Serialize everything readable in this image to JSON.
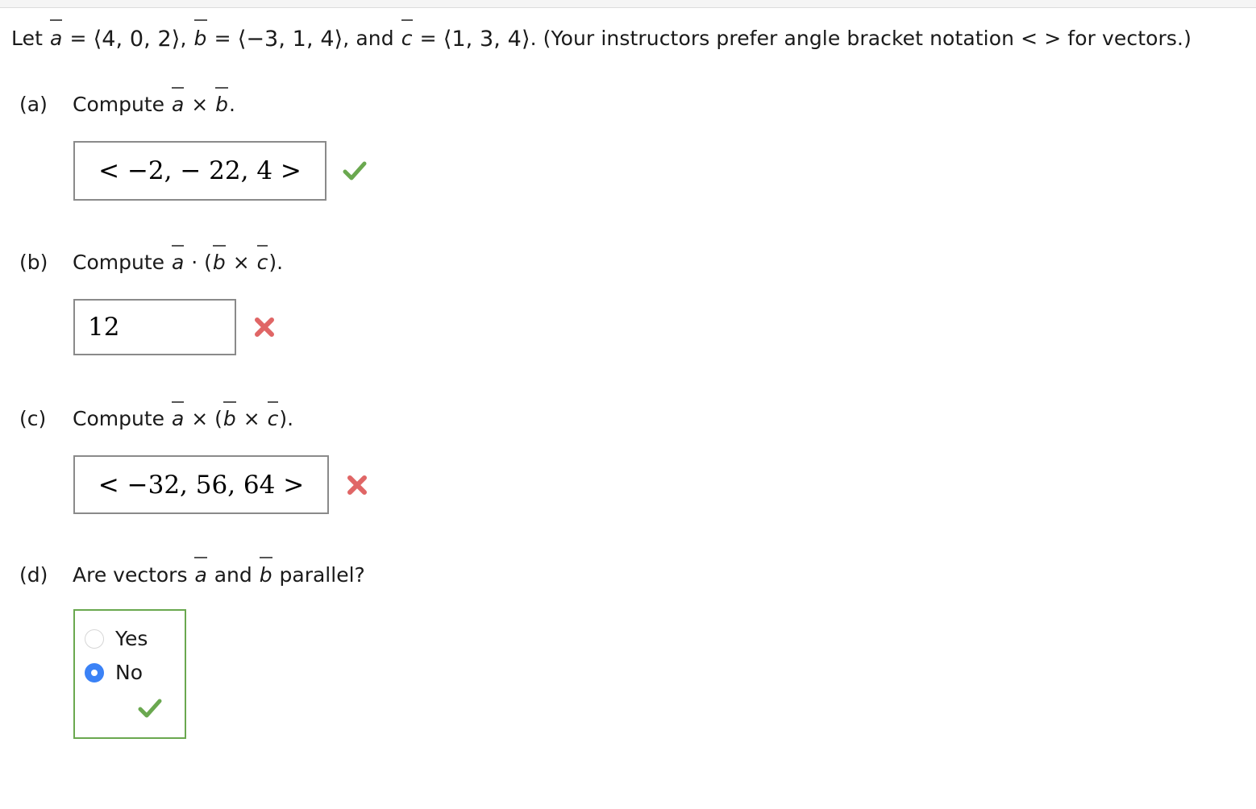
{
  "prompt": {
    "let_text": "Let ",
    "vec_a": "a",
    "eq1": " = ",
    "a_components": "⟨4, 0, 2⟩",
    "sep1": ", ",
    "vec_b": "b",
    "eq2": " = ",
    "b_components": "⟨−3, 1, 4⟩",
    "sep2": ", and ",
    "vec_c": "c",
    "eq3": " = ",
    "c_components": "⟨1, 3, 4⟩",
    "note": ". (Your instructors prefer angle bracket notation < > for vectors.)"
  },
  "parts": {
    "a": {
      "label": "(a)",
      "text_before": "Compute ",
      "vec1": "a",
      "operator": " × ",
      "vec2": "b",
      "text_after": ".",
      "answer": "< −2, − 22, 4 >",
      "status": "correct",
      "status_icon": "green-check-icon"
    },
    "b": {
      "label": "(b)",
      "text_before": "Compute ",
      "vec1": "a",
      "operator": " · (",
      "vec2": "b",
      "operator2": " × ",
      "vec3": "c",
      "text_after": ").",
      "answer": "12",
      "status": "incorrect",
      "status_icon": "red-x-icon"
    },
    "c": {
      "label": "(c)",
      "text_before": "Compute ",
      "vec1": "a",
      "operator": " × (",
      "vec2": "b",
      "operator2": " × ",
      "vec3": "c",
      "text_after": ").",
      "answer": "< −32, 56, 64 >",
      "status": "incorrect",
      "status_icon": "red-x-icon"
    },
    "d": {
      "label": "(d)",
      "text_before": "Are vectors ",
      "vec1": "a",
      "operator": " and ",
      "vec2": "b",
      "text_after": " parallel?",
      "options": [
        {
          "label": "Yes",
          "selected": false
        },
        {
          "label": "No",
          "selected": true
        }
      ],
      "status": "correct",
      "status_icon": "green-check-icon"
    }
  },
  "colors": {
    "correct_green": "#6aa84f",
    "incorrect_red": "#e06666",
    "radio_blue": "#3b82f6",
    "box_border_gray": "#8a8a8a",
    "group_border_green": "#6aa84f"
  }
}
